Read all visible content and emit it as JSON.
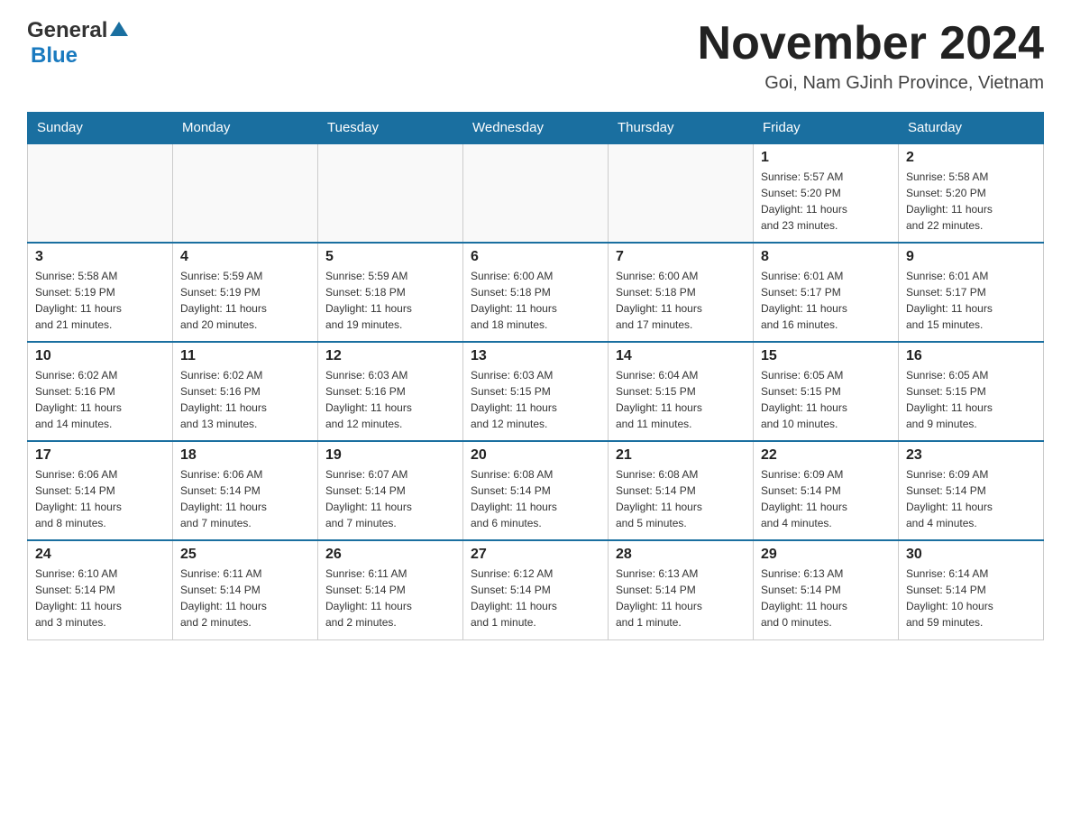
{
  "header": {
    "logo_general": "General",
    "logo_blue": "Blue",
    "title": "November 2024",
    "location": "Goi, Nam GJinh Province, Vietnam"
  },
  "days_of_week": [
    "Sunday",
    "Monday",
    "Tuesday",
    "Wednesday",
    "Thursday",
    "Friday",
    "Saturday"
  ],
  "weeks": [
    {
      "days": [
        {
          "date": "",
          "info": ""
        },
        {
          "date": "",
          "info": ""
        },
        {
          "date": "",
          "info": ""
        },
        {
          "date": "",
          "info": ""
        },
        {
          "date": "",
          "info": ""
        },
        {
          "date": "1",
          "info": "Sunrise: 5:57 AM\nSunset: 5:20 PM\nDaylight: 11 hours\nand 23 minutes."
        },
        {
          "date": "2",
          "info": "Sunrise: 5:58 AM\nSunset: 5:20 PM\nDaylight: 11 hours\nand 22 minutes."
        }
      ]
    },
    {
      "days": [
        {
          "date": "3",
          "info": "Sunrise: 5:58 AM\nSunset: 5:19 PM\nDaylight: 11 hours\nand 21 minutes."
        },
        {
          "date": "4",
          "info": "Sunrise: 5:59 AM\nSunset: 5:19 PM\nDaylight: 11 hours\nand 20 minutes."
        },
        {
          "date": "5",
          "info": "Sunrise: 5:59 AM\nSunset: 5:18 PM\nDaylight: 11 hours\nand 19 minutes."
        },
        {
          "date": "6",
          "info": "Sunrise: 6:00 AM\nSunset: 5:18 PM\nDaylight: 11 hours\nand 18 minutes."
        },
        {
          "date": "7",
          "info": "Sunrise: 6:00 AM\nSunset: 5:18 PM\nDaylight: 11 hours\nand 17 minutes."
        },
        {
          "date": "8",
          "info": "Sunrise: 6:01 AM\nSunset: 5:17 PM\nDaylight: 11 hours\nand 16 minutes."
        },
        {
          "date": "9",
          "info": "Sunrise: 6:01 AM\nSunset: 5:17 PM\nDaylight: 11 hours\nand 15 minutes."
        }
      ]
    },
    {
      "days": [
        {
          "date": "10",
          "info": "Sunrise: 6:02 AM\nSunset: 5:16 PM\nDaylight: 11 hours\nand 14 minutes."
        },
        {
          "date": "11",
          "info": "Sunrise: 6:02 AM\nSunset: 5:16 PM\nDaylight: 11 hours\nand 13 minutes."
        },
        {
          "date": "12",
          "info": "Sunrise: 6:03 AM\nSunset: 5:16 PM\nDaylight: 11 hours\nand 12 minutes."
        },
        {
          "date": "13",
          "info": "Sunrise: 6:03 AM\nSunset: 5:15 PM\nDaylight: 11 hours\nand 12 minutes."
        },
        {
          "date": "14",
          "info": "Sunrise: 6:04 AM\nSunset: 5:15 PM\nDaylight: 11 hours\nand 11 minutes."
        },
        {
          "date": "15",
          "info": "Sunrise: 6:05 AM\nSunset: 5:15 PM\nDaylight: 11 hours\nand 10 minutes."
        },
        {
          "date": "16",
          "info": "Sunrise: 6:05 AM\nSunset: 5:15 PM\nDaylight: 11 hours\nand 9 minutes."
        }
      ]
    },
    {
      "days": [
        {
          "date": "17",
          "info": "Sunrise: 6:06 AM\nSunset: 5:14 PM\nDaylight: 11 hours\nand 8 minutes."
        },
        {
          "date": "18",
          "info": "Sunrise: 6:06 AM\nSunset: 5:14 PM\nDaylight: 11 hours\nand 7 minutes."
        },
        {
          "date": "19",
          "info": "Sunrise: 6:07 AM\nSunset: 5:14 PM\nDaylight: 11 hours\nand 7 minutes."
        },
        {
          "date": "20",
          "info": "Sunrise: 6:08 AM\nSunset: 5:14 PM\nDaylight: 11 hours\nand 6 minutes."
        },
        {
          "date": "21",
          "info": "Sunrise: 6:08 AM\nSunset: 5:14 PM\nDaylight: 11 hours\nand 5 minutes."
        },
        {
          "date": "22",
          "info": "Sunrise: 6:09 AM\nSunset: 5:14 PM\nDaylight: 11 hours\nand 4 minutes."
        },
        {
          "date": "23",
          "info": "Sunrise: 6:09 AM\nSunset: 5:14 PM\nDaylight: 11 hours\nand 4 minutes."
        }
      ]
    },
    {
      "days": [
        {
          "date": "24",
          "info": "Sunrise: 6:10 AM\nSunset: 5:14 PM\nDaylight: 11 hours\nand 3 minutes."
        },
        {
          "date": "25",
          "info": "Sunrise: 6:11 AM\nSunset: 5:14 PM\nDaylight: 11 hours\nand 2 minutes."
        },
        {
          "date": "26",
          "info": "Sunrise: 6:11 AM\nSunset: 5:14 PM\nDaylight: 11 hours\nand 2 minutes."
        },
        {
          "date": "27",
          "info": "Sunrise: 6:12 AM\nSunset: 5:14 PM\nDaylight: 11 hours\nand 1 minute."
        },
        {
          "date": "28",
          "info": "Sunrise: 6:13 AM\nSunset: 5:14 PM\nDaylight: 11 hours\nand 1 minute."
        },
        {
          "date": "29",
          "info": "Sunrise: 6:13 AM\nSunset: 5:14 PM\nDaylight: 11 hours\nand 0 minutes."
        },
        {
          "date": "30",
          "info": "Sunrise: 6:14 AM\nSunset: 5:14 PM\nDaylight: 10 hours\nand 59 minutes."
        }
      ]
    }
  ]
}
